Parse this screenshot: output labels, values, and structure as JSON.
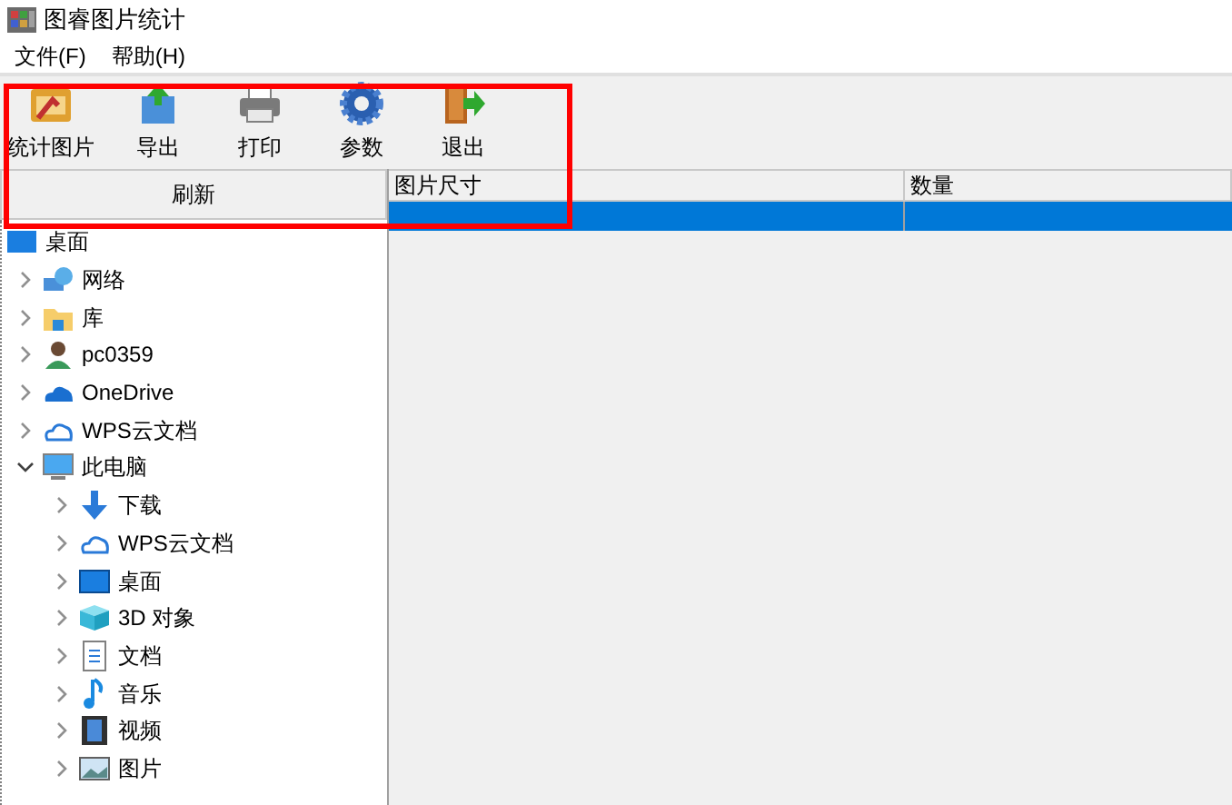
{
  "window": {
    "title": "图睿图片统计"
  },
  "menu": [
    "文件(F)",
    "帮助(H)"
  ],
  "toolbar": [
    "统计图片",
    "导出",
    "打印",
    "参数",
    "退出"
  ],
  "refresh_button": "刷新",
  "tree": {
    "label": "桌面",
    "children": [
      {
        "label": "网络",
        "expanded": false
      },
      {
        "label": "库",
        "expanded": false
      },
      {
        "label": "pc0359",
        "expanded": false
      },
      {
        "label": "OneDrive",
        "expanded": false
      },
      {
        "label": "WPS云文档",
        "expanded": false
      },
      {
        "label": "此电脑",
        "expanded": true,
        "children": [
          {
            "label": "下载",
            "expanded": false
          },
          {
            "label": "WPS云文档",
            "expanded": false
          },
          {
            "label": "桌面",
            "expanded": false
          },
          {
            "label": "3D 对象",
            "expanded": false
          },
          {
            "label": "文档",
            "expanded": false
          },
          {
            "label": "音乐",
            "expanded": false
          },
          {
            "label": "视频",
            "expanded": false
          },
          {
            "label": "图片",
            "expanded": false
          }
        ]
      }
    ]
  },
  "table": {
    "columns": [
      "图片尺寸",
      "数量"
    ],
    "rows": [
      {
        "selected": true
      }
    ]
  }
}
